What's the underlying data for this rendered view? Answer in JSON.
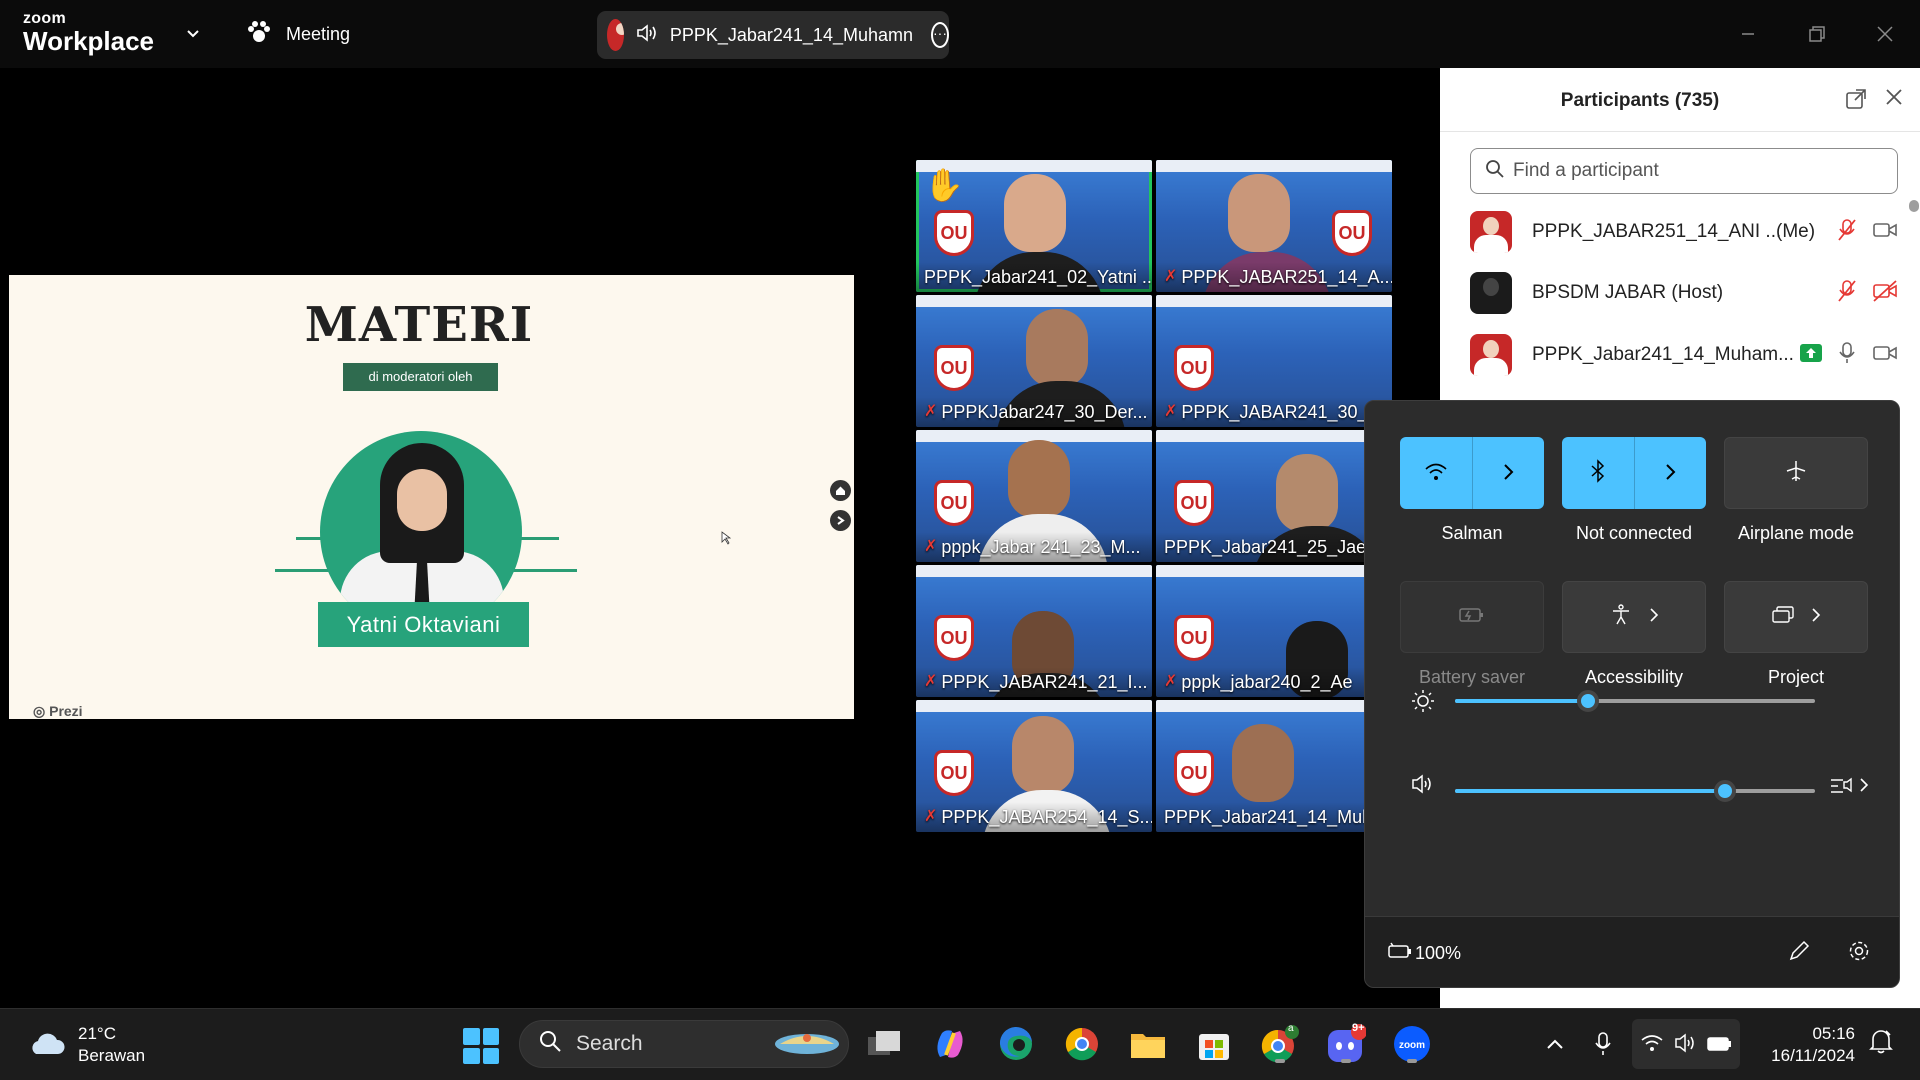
{
  "topbar": {
    "brand_small": "zoom",
    "brand_big": "Workplace",
    "meeting_label": "Meeting",
    "active_speaker": "PPPK_Jabar241_14_Muhamn"
  },
  "slide": {
    "title": "MATERI",
    "subtitle": "di moderatori oleh",
    "presenter_name": "Yatni Oktaviani",
    "footer_brand": "Prezi"
  },
  "video_grid": {
    "tiles": [
      {
        "name": "PPPK_Jabar241_02_Yatni ...",
        "muted": false,
        "hand_raised": true,
        "active": true
      },
      {
        "name": "PPPK_JABAR251_14_A...",
        "muted": true,
        "hand_raised": false,
        "active": false
      },
      {
        "name": "PPPKJabar247_30_Der...",
        "muted": true,
        "hand_raised": false,
        "active": false
      },
      {
        "name": "PPPK_JABAR241_30_",
        "muted": true,
        "hand_raised": false,
        "active": false
      },
      {
        "name": "pppk_Jabar 241_23_M...",
        "muted": true,
        "hand_raised": false,
        "active": false
      },
      {
        "name": "PPPK_Jabar241_25_Jaen",
        "muted": false,
        "hand_raised": false,
        "active": false
      },
      {
        "name": "PPPK_JABAR241_21_I...",
        "muted": true,
        "hand_raised": false,
        "active": false
      },
      {
        "name": "pppk_jabar240_2_Ae",
        "muted": true,
        "hand_raised": false,
        "active": false
      },
      {
        "name": "PPPK_JABAR254_14_S...",
        "muted": true,
        "hand_raised": false,
        "active": false
      },
      {
        "name": "PPPK_Jabar241_14_Muh",
        "muted": false,
        "hand_raised": false,
        "active": false
      }
    ],
    "logo_text": "OU"
  },
  "participants": {
    "title": "Participants (735)",
    "search_placeholder": "Find a participant",
    "items": [
      {
        "name": "PPPK_JABAR251_14_ANI ...",
        "tag": "(Me)",
        "mic": "muted",
        "video": "on"
      },
      {
        "name": "BPSDM JABAR (Host)",
        "tag": "",
        "mic": "muted",
        "video": "off"
      },
      {
        "name": "PPPK_Jabar241_14_Muham...",
        "tag": "",
        "mic": "on",
        "video": "on",
        "sharing": true
      }
    ]
  },
  "quick_settings": {
    "wifi_label": "Salman",
    "bluetooth_label": "Not connected",
    "airplane_label": "Airplane mode",
    "battery_saver_label": "Battery saver",
    "accessibility_label": "Accessibility",
    "project_label": "Project",
    "brightness_value": 0.37,
    "volume_value": 0.75,
    "battery_text": "100%"
  },
  "taskbar": {
    "weather_temp": "21°C",
    "weather_desc": "Berawan",
    "search_label": "Search",
    "time": "05:16",
    "date": "16/11/2024",
    "discord_badge": "9+",
    "chrome_badge": "a",
    "colors": {
      "accent": "#4cc2ff",
      "zoom": "#0b5cff"
    }
  }
}
